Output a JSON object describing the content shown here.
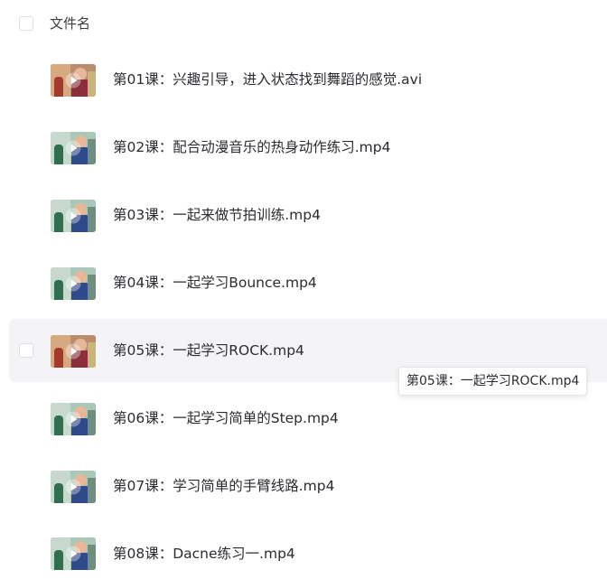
{
  "header": {
    "column_label": "文件名"
  },
  "files": [
    {
      "name": "第01课：兴趣引导，进入状态找到舞蹈的感觉.avi",
      "thumbnail": "video-thumbnail-icon"
    },
    {
      "name": "第02课：配合动漫音乐的热身动作练习.mp4",
      "thumbnail": "video-thumbnail-icon"
    },
    {
      "name": "第03课：一起来做节拍训练.mp4",
      "thumbnail": "video-thumbnail-icon"
    },
    {
      "name": "第04课：一起学习Bounce.mp4",
      "thumbnail": "video-thumbnail-icon"
    },
    {
      "name": "第05课：一起学习ROCK.mp4",
      "thumbnail": "video-thumbnail-icon"
    },
    {
      "name": "第06课：一起学习简单的Step.mp4",
      "thumbnail": "video-thumbnail-icon"
    },
    {
      "name": "第07课：学习简单的手臂线路.mp4",
      "thumbnail": "video-thumbnail-icon"
    },
    {
      "name": "第08课：Dacne练习一.mp4",
      "thumbnail": "video-thumbnail-icon"
    }
  ],
  "tooltip": {
    "text": "第05课：一起学习ROCK.mp4"
  },
  "colors": {
    "hover_row_background": "#f4f4f6",
    "text": "#2b2c31",
    "checkbox_border": "#dcdfe6"
  }
}
